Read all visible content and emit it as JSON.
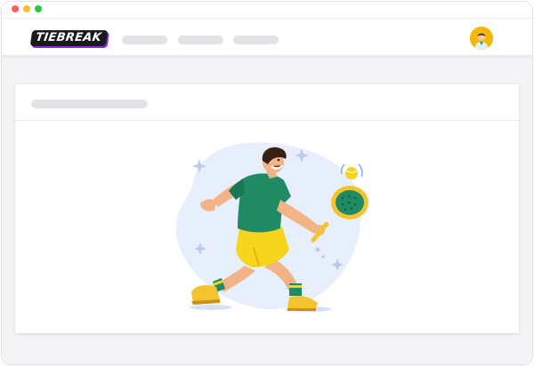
{
  "app": {
    "logo_text": "TIEBREAK"
  },
  "window": {
    "controls": [
      "close",
      "minimize",
      "maximize"
    ]
  },
  "navbar": {
    "placeholder_links": 3,
    "avatar_icon": "user-avatar-icon"
  },
  "content": {
    "card_title_placeholder": true,
    "illustration": "tennis-player-illustration"
  },
  "colors": {
    "accent_yellow": "#f5b800",
    "shirt_green": "#1f8a63",
    "shorts_yellow": "#f7d51d",
    "backdrop_blue": "#e6effb"
  }
}
